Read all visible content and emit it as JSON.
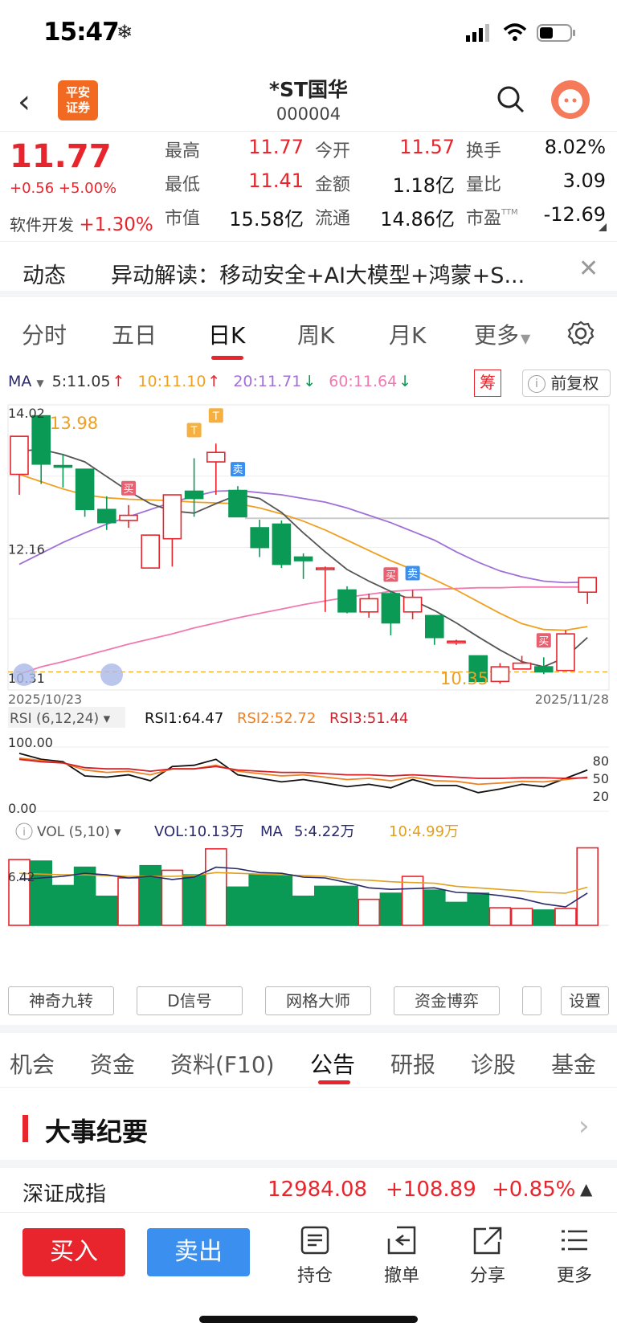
{
  "status": {
    "time": "15:47",
    "weather_glyph": "❄"
  },
  "header": {
    "logo_line1": "平安",
    "logo_line2": "证券",
    "stock_name": "*ST国华",
    "stock_code": "000004"
  },
  "quote": {
    "price": "11.77",
    "change": "+0.56 +5.00%",
    "sector_name": "软件开发",
    "sector_change": "+1.30%",
    "rows": [
      [
        {
          "label": "最高",
          "value": "11.77",
          "color": "red"
        },
        {
          "label": "今开",
          "value": "11.57",
          "color": "red"
        },
        {
          "label": "换手",
          "value": "8.02%",
          "color": "black"
        }
      ],
      [
        {
          "label": "最低",
          "value": "11.41",
          "color": "red"
        },
        {
          "label": "金额",
          "value": "1.18亿",
          "color": "black"
        },
        {
          "label": "量比",
          "value": "3.09",
          "color": "black"
        }
      ],
      [
        {
          "label": "市值",
          "value": "15.58亿",
          "color": "black"
        },
        {
          "label": "流通",
          "value": "14.86亿",
          "color": "black"
        },
        {
          "label": "市盈",
          "value": "-12.69",
          "color": "black",
          "sup": "TTM"
        }
      ]
    ]
  },
  "notice": {
    "label": "动态",
    "text": "异动解读：移动安全+AI大模型+鸿蒙+S..."
  },
  "chart_tabs": [
    {
      "label": "分时",
      "active": false
    },
    {
      "label": "五日",
      "active": false
    },
    {
      "label": "日K",
      "active": true
    },
    {
      "label": "周K",
      "active": false
    },
    {
      "label": "月K",
      "active": false
    },
    {
      "label": "更多",
      "active": false
    }
  ],
  "ma_legend": {
    "title": "MA",
    "items": [
      {
        "text": "5:11.05",
        "arrow": "↑",
        "color": "#333333",
        "arrow_color": "#e8242c"
      },
      {
        "text": "10:11.10",
        "arrow": "↑",
        "color": "#f0a020",
        "arrow_color": "#e8242c"
      },
      {
        "text": "20:11.71",
        "arrow": "↓",
        "color": "#a070d8",
        "arrow_color": "#0a9a56"
      },
      {
        "text": "60:11.64",
        "arrow": "↓",
        "color": "#f07ab0",
        "arrow_color": "#0a9a56"
      }
    ],
    "chou_label": "筹",
    "fq_label": "前复权"
  },
  "chart_data": [
    {
      "type": "candlestick",
      "y_ticks": [
        "14.02",
        "12.16",
        "10.31"
      ],
      "ylim": [
        10.31,
        14.02
      ],
      "x_start_label": "2025/10/23",
      "x_end_label": "2025/11/28",
      "high_annotation": "13.98",
      "low_annotation": "10.35",
      "candles": [
        {
          "o": 13.18,
          "h": 13.7,
          "l": 12.9,
          "c": 13.7
        },
        {
          "o": 13.98,
          "h": 13.98,
          "l": 13.05,
          "c": 13.32
        },
        {
          "o": 13.3,
          "h": 13.45,
          "l": 13.0,
          "c": 13.28
        },
        {
          "o": 13.25,
          "h": 13.25,
          "l": 12.6,
          "c": 12.7
        },
        {
          "o": 12.7,
          "h": 12.88,
          "l": 12.42,
          "c": 12.52
        },
        {
          "o": 12.55,
          "h": 12.76,
          "l": 12.45,
          "c": 12.62
        },
        {
          "o": 11.9,
          "h": 12.35,
          "l": 11.9,
          "c": 12.35
        },
        {
          "o": 12.3,
          "h": 12.9,
          "l": 11.92,
          "c": 12.9
        },
        {
          "o": 12.95,
          "h": 13.4,
          "l": 12.6,
          "c": 12.85
        },
        {
          "o": 13.35,
          "h": 13.6,
          "l": 12.9,
          "c": 13.48
        },
        {
          "o": 12.96,
          "h": 13.02,
          "l": 12.6,
          "c": 12.6
        },
        {
          "o": 12.45,
          "h": 12.56,
          "l": 12.05,
          "c": 12.18
        },
        {
          "o": 12.5,
          "h": 12.55,
          "l": 11.9,
          "c": 11.95
        },
        {
          "o": 12.05,
          "h": 12.1,
          "l": 11.75,
          "c": 12.0
        },
        {
          "o": 11.88,
          "h": 11.92,
          "l": 11.3,
          "c": 11.9
        },
        {
          "o": 11.6,
          "h": 11.65,
          "l": 11.28,
          "c": 11.3
        },
        {
          "o": 11.3,
          "h": 11.55,
          "l": 11.22,
          "c": 11.48
        },
        {
          "o": 11.55,
          "h": 11.58,
          "l": 10.98,
          "c": 11.15
        },
        {
          "o": 11.3,
          "h": 11.6,
          "l": 11.2,
          "c": 11.5
        },
        {
          "o": 11.25,
          "h": 11.25,
          "l": 10.85,
          "c": 10.95
        },
        {
          "o": 10.88,
          "h": 10.92,
          "l": 10.85,
          "c": 10.9
        },
        {
          "o": 10.7,
          "h": 10.7,
          "l": 10.35,
          "c": 10.35
        },
        {
          "o": 10.35,
          "h": 10.6,
          "l": 10.32,
          "c": 10.55
        },
        {
          "o": 10.52,
          "h": 10.7,
          "l": 10.52,
          "c": 10.6
        },
        {
          "o": 10.55,
          "h": 10.68,
          "l": 10.45,
          "c": 10.48
        },
        {
          "o": 10.5,
          "h": 11.05,
          "l": 10.5,
          "c": 11.0
        },
        {
          "o": 11.57,
          "h": 11.77,
          "l": 11.41,
          "c": 11.77
        }
      ],
      "ma5": [
        13.5,
        13.52,
        13.45,
        13.35,
        13.15,
        12.95,
        12.78,
        12.68,
        12.65,
        12.78,
        12.9,
        12.85,
        12.66,
        12.38,
        12.12,
        11.88,
        11.72,
        11.58,
        11.46,
        11.32,
        11.15,
        10.96,
        10.78,
        10.62,
        10.55,
        10.68,
        10.95
      ],
      "ma10": [
        13.18,
        13.08,
        12.98,
        12.9,
        12.86,
        12.84,
        12.83,
        12.82,
        12.8,
        12.79,
        12.78,
        12.72,
        12.64,
        12.54,
        12.42,
        12.28,
        12.14,
        12.0,
        11.88,
        11.74,
        11.6,
        11.44,
        11.28,
        11.14,
        11.06,
        11.05,
        11.1
      ],
      "ma20": [
        11.95,
        12.1,
        12.25,
        12.38,
        12.5,
        12.6,
        12.7,
        12.8,
        12.88,
        12.95,
        12.96,
        12.93,
        12.9,
        12.85,
        12.8,
        12.72,
        12.62,
        12.52,
        12.4,
        12.28,
        12.12,
        11.98,
        11.86,
        11.78,
        11.72,
        11.7,
        11.71
      ],
      "ma60": [
        10.45,
        10.55,
        10.62,
        10.7,
        10.78,
        10.86,
        10.93,
        11.0,
        11.08,
        11.15,
        11.22,
        11.28,
        11.34,
        11.4,
        11.45,
        11.5,
        11.54,
        11.58,
        11.6,
        11.61,
        11.62,
        11.63,
        11.63,
        11.64,
        11.64,
        11.64,
        11.64
      ],
      "signals": [
        {
          "index": 5,
          "text": "买",
          "kind": "buy"
        },
        {
          "index": 8,
          "text": "T",
          "kind": "t"
        },
        {
          "index": 9,
          "text": "T",
          "kind": "t"
        },
        {
          "index": 10,
          "text": "卖",
          "kind": "sell"
        },
        {
          "index": 17,
          "text": "买",
          "kind": "buy"
        },
        {
          "index": 18,
          "text": "卖",
          "kind": "sell"
        },
        {
          "index": 24,
          "text": "买",
          "kind": "buy"
        }
      ]
    },
    {
      "type": "line",
      "name": "RSI (6,12,24)",
      "legend": [
        {
          "text": "RSI1:64.47",
          "color": "#111111"
        },
        {
          "text": "RSI2:52.72",
          "color": "#f08020"
        },
        {
          "text": "RSI3:51.44",
          "color": "#d0202a"
        }
      ],
      "y_left_ticks": [
        "100.00",
        "0.00"
      ],
      "y_right_ticks": [
        "80",
        "50",
        "20"
      ],
      "ylim": [
        0,
        100
      ],
      "series": [
        {
          "name": "RSI1",
          "values": [
            92,
            82,
            78,
            54,
            52,
            56,
            46,
            70,
            72,
            82,
            56,
            50,
            44,
            48,
            42,
            36,
            40,
            34,
            48,
            38,
            38,
            26,
            32,
            40,
            36,
            50,
            64
          ]
        },
        {
          "name": "RSI2",
          "values": [
            84,
            80,
            76,
            64,
            60,
            62,
            56,
            66,
            66,
            72,
            62,
            58,
            54,
            56,
            52,
            48,
            50,
            46,
            52,
            46,
            45,
            40,
            42,
            45,
            44,
            48,
            52
          ]
        },
        {
          "name": "RSI3",
          "values": [
            82,
            78,
            76,
            68,
            66,
            66,
            62,
            66,
            66,
            70,
            64,
            62,
            60,
            60,
            58,
            56,
            56,
            54,
            56,
            54,
            52,
            50,
            50,
            51,
            51,
            50,
            51
          ]
        }
      ]
    },
    {
      "type": "bar",
      "name": "VOL (5,10)",
      "legend": [
        {
          "text": "VOL:10.13万",
          "color": "#2a2a6a"
        },
        {
          "text": "MA",
          "color": "#2a2a6a"
        },
        {
          "text": "5:4.22万",
          "color": "#2a2a6a"
        },
        {
          "text": "10:4.99万",
          "color": "#e0a020"
        }
      ],
      "y_tick": "6.42",
      "ylim": [
        0,
        10.5
      ],
      "values": [
        8.6,
        8.4,
        5.2,
        7.6,
        3.8,
        6.2,
        7.8,
        7.2,
        6.6,
        10.0,
        5.0,
        6.6,
        6.6,
        3.8,
        5.1,
        5.1,
        3.4,
        4.2,
        6.4,
        4.6,
        3.0,
        4.2,
        2.3,
        2.2,
        2.0,
        2.2,
        10.13
      ],
      "up": [
        true,
        false,
        false,
        false,
        false,
        true,
        false,
        true,
        false,
        true,
        false,
        false,
        false,
        false,
        false,
        false,
        true,
        false,
        true,
        false,
        false,
        false,
        true,
        true,
        false,
        true,
        true
      ],
      "ma5": [
        6.0,
        6.2,
        6.4,
        6.8,
        6.6,
        6.2,
        6.4,
        6.0,
        6.3,
        7.6,
        7.4,
        6.9,
        6.8,
        6.3,
        6.2,
        5.6,
        4.9,
        4.7,
        4.8,
        4.9,
        4.3,
        4.2,
        3.9,
        3.5,
        2.8,
        2.4,
        4.22
      ],
      "ma10": [
        6.8,
        6.7,
        6.6,
        6.6,
        6.5,
        6.4,
        6.4,
        6.4,
        6.5,
        6.9,
        6.8,
        6.7,
        6.6,
        6.5,
        6.4,
        6.0,
        5.9,
        5.7,
        5.6,
        5.5,
        5.1,
        4.9,
        4.7,
        4.5,
        4.3,
        4.2,
        4.99
      ]
    }
  ],
  "rsi_label": "RSI (6,12,24)",
  "vol_label": "VOL (5,10)",
  "tools": [
    "神奇九转",
    "D信号",
    "网格大师",
    "资金博弈",
    "",
    "设置"
  ],
  "bottom_tabs": [
    {
      "label": "机会",
      "active": false
    },
    {
      "label": "资金",
      "active": false
    },
    {
      "label": "资料(F10)",
      "active": false
    },
    {
      "label": "公告",
      "active": true
    },
    {
      "label": "研报",
      "active": false
    },
    {
      "label": "诊股",
      "active": false
    },
    {
      "label": "基金",
      "active": false
    }
  ],
  "event": {
    "title": "大事纪要"
  },
  "index_ticker": {
    "name": "深证成指",
    "value": "12984.08",
    "change": "+108.89",
    "pct": "+0.85%"
  },
  "bottom_bar": {
    "buy": "买入",
    "sell": "卖出",
    "items": [
      {
        "label": "持仓",
        "icon": "holdings-icon"
      },
      {
        "label": "撤单",
        "icon": "cancel-order-icon"
      },
      {
        "label": "分享",
        "icon": "share-icon"
      },
      {
        "label": "更多",
        "icon": "more-icon"
      }
    ]
  },
  "colors": {
    "up": "#e8242c",
    "down": "#0a9a56",
    "accent_orange": "#f26a21",
    "sell_blue": "#3b8fef"
  }
}
